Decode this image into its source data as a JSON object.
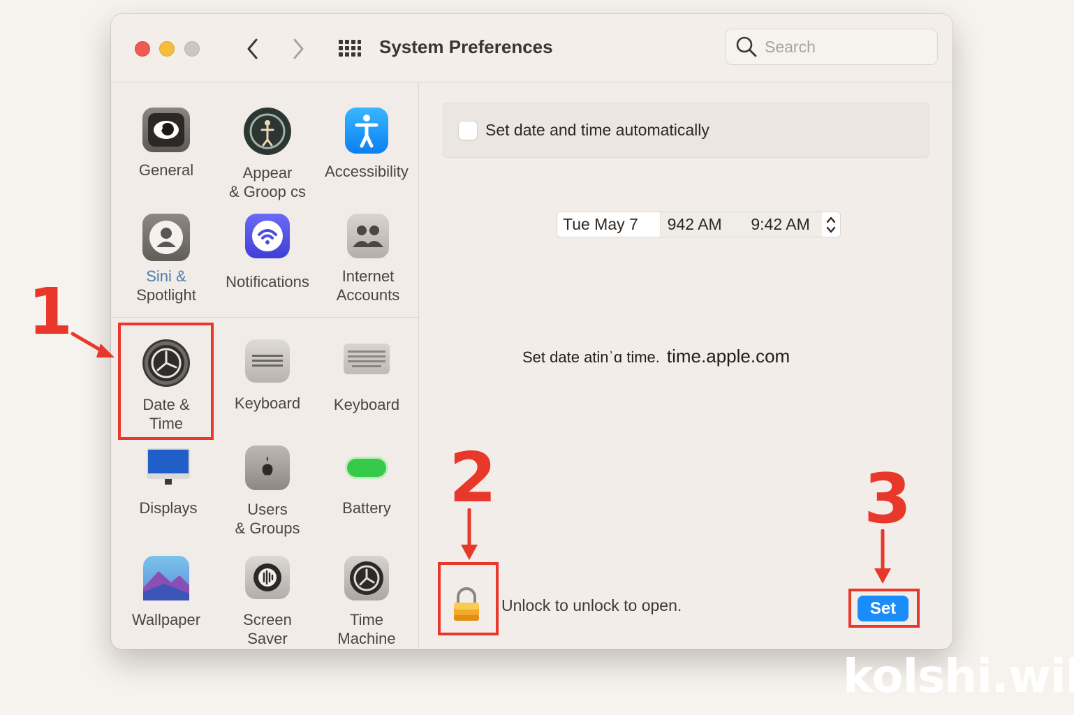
{
  "window": {
    "title": "System Preferences",
    "search_placeholder": "Search"
  },
  "sidebar": {
    "items": [
      {
        "label": "General",
        "icon": "general-icon"
      },
      {
        "label": "Appear\n& Groop cs",
        "icon": "appearance-icon"
      },
      {
        "label": "Accessibility",
        "icon": "accessibility-icon"
      },
      {
        "label_blue": "Sini &",
        "label": "Spotlight",
        "icon": "siri-icon"
      },
      {
        "label": "Notifications",
        "icon": "notifications-icon"
      },
      {
        "label": "Internet\nAccounts",
        "icon": "internet-accounts-icon"
      },
      {
        "label": "Date &\nTime",
        "icon": "clock-icon"
      },
      {
        "label": "Keyboard",
        "icon": "keyboard-icon"
      },
      {
        "label": "Keyboard",
        "icon": "keyboard-icon"
      },
      {
        "label": "Displays",
        "icon": "display-icon"
      },
      {
        "label": "Users\n& Groups",
        "icon": "users-icon"
      },
      {
        "label": "Battery",
        "icon": "battery-icon"
      },
      {
        "label": "Wallpaper",
        "icon": "wallpaper-icon"
      },
      {
        "label": "Screen\nSaver",
        "icon": "screen-saver-icon"
      },
      {
        "label": "Time\nMachine",
        "icon": "time-machine-icon"
      }
    ]
  },
  "content": {
    "auto_label": "Set date and time automatically",
    "auto_checked": false,
    "date": "Tue May 7",
    "time1": "942 AM",
    "time2": "9:42 AM",
    "server_label": "Set date atinʾɑ time.",
    "server": "time.apple.com",
    "unlock_text": "Unlock to unlock to open.",
    "set_label": "Set"
  },
  "annotations": {
    "step1": "1",
    "step2": "2",
    "step3": "3",
    "color": "#e8372b"
  },
  "watermark": "kolshi.wiki",
  "colors": {
    "accent": "#1b8dfb",
    "close": "#ee5b52",
    "minimize": "#f4bd3b"
  }
}
